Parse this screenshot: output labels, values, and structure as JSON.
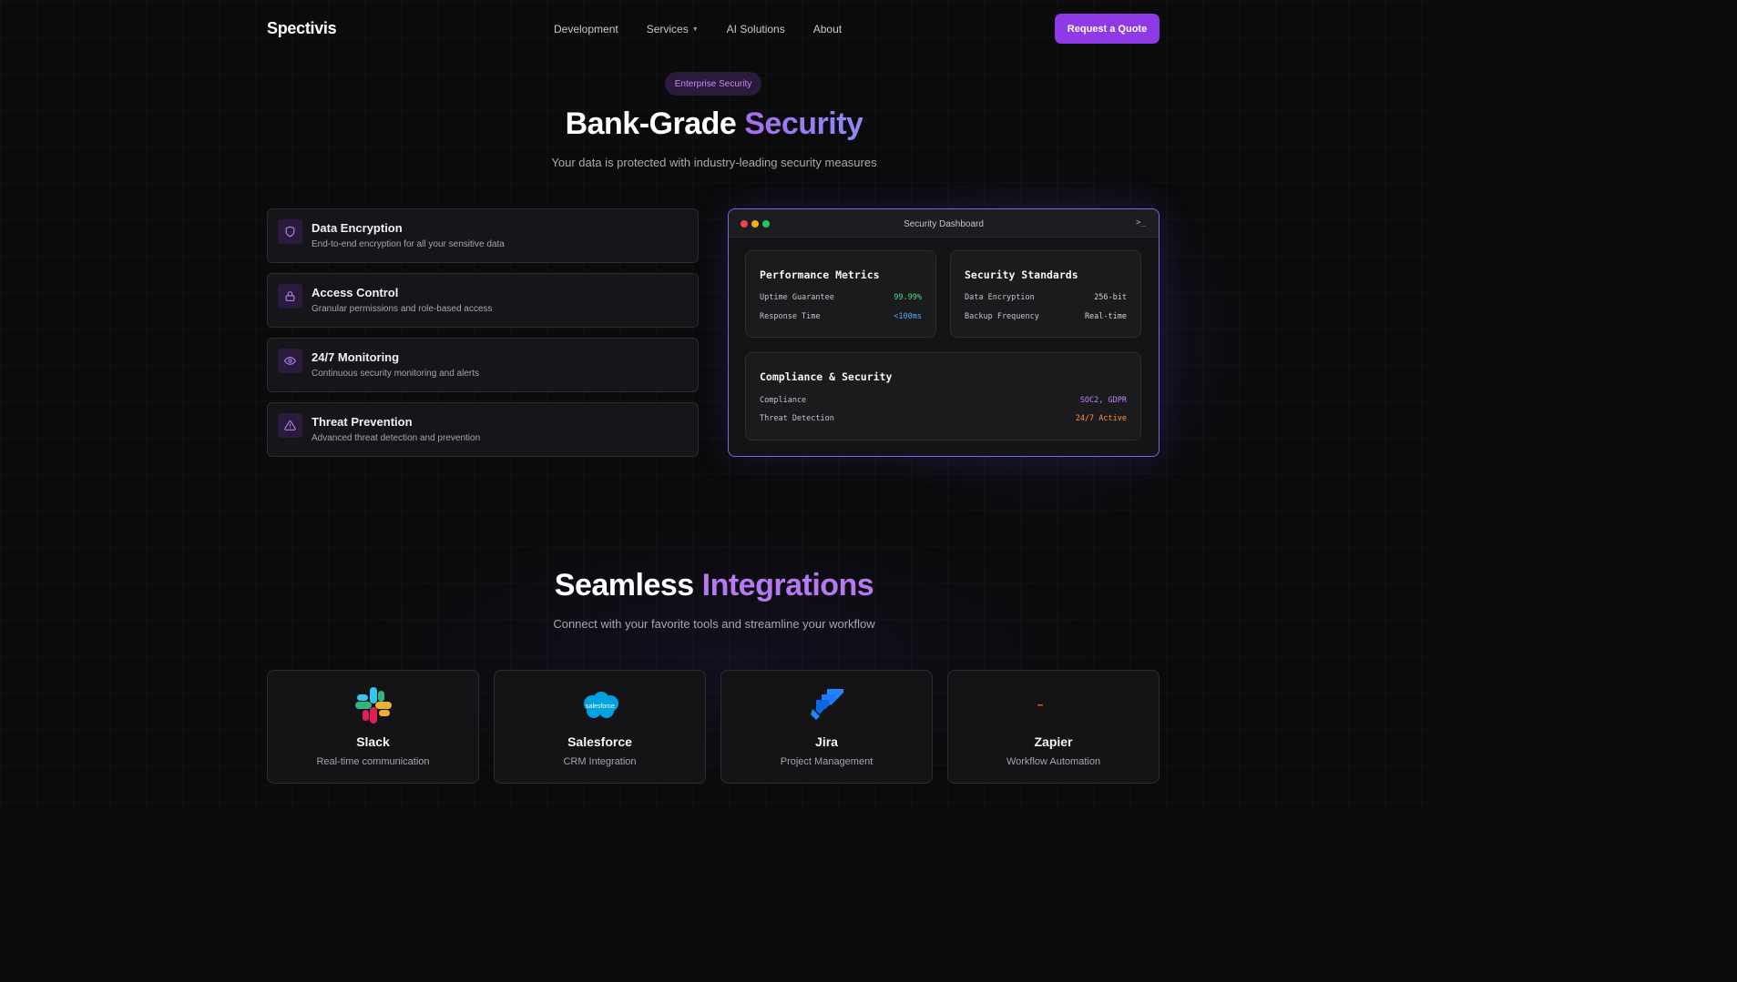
{
  "nav": {
    "logo": "Spectivis",
    "links": [
      "Development",
      "Services",
      "AI Solutions",
      "About"
    ],
    "cta": "Request a Quote"
  },
  "security": {
    "badge": "Enterprise Security",
    "title_main": "Bank-Grade ",
    "title_accent": "Security",
    "subtitle": "Your data is protected with industry-leading security measures",
    "features": [
      {
        "title": "Data Encryption",
        "desc": "End-to-end encryption for all your sensitive data",
        "icon": "shield-icon"
      },
      {
        "title": "Access Control",
        "desc": "Granular permissions and role-based access",
        "icon": "lock-icon"
      },
      {
        "title": "24/7 Monitoring",
        "desc": "Continuous security monitoring and alerts",
        "icon": "eye-icon"
      },
      {
        "title": "Threat Prevention",
        "desc": "Advanced threat detection and prevention",
        "icon": "warning-icon"
      }
    ]
  },
  "dashboard": {
    "title": "Security Dashboard",
    "terminal_icon": ">_",
    "performance": {
      "title": "Performance Metrics",
      "rows": [
        {
          "label": "Uptime Guarantee",
          "value": "99.99%",
          "color": "#4ade80"
        },
        {
          "label": "Response Time",
          "value": "<100ms",
          "color": "#60a5fa"
        }
      ]
    },
    "standards": {
      "title": "Security Standards",
      "rows": [
        {
          "label": "Data Encryption",
          "value": "256-bit",
          "color": "#d4d4d8"
        },
        {
          "label": "Backup Frequency",
          "value": "Real-time",
          "color": "#d4d4d8"
        }
      ]
    },
    "compliance": {
      "title": "Compliance & Security",
      "rows": [
        {
          "label": "Compliance",
          "value": "SOC2, GDPR",
          "color": "#c084fc"
        },
        {
          "label": "Threat Detection",
          "value": "24/7 Active",
          "color": "#fb923c"
        }
      ]
    }
  },
  "integrations": {
    "title_main": "Seamless ",
    "title_accent": "Integrations",
    "subtitle": "Connect with your favorite tools and streamline your workflow",
    "items": [
      {
        "name": "Slack",
        "desc": "Real-time communication",
        "icon": "slack-logo-icon"
      },
      {
        "name": "Salesforce",
        "desc": "CRM Integration",
        "icon": "salesforce-logo-icon",
        "logo_text": "salesforce"
      },
      {
        "name": "Jira",
        "desc": "Project Management",
        "icon": "jira-logo-icon"
      },
      {
        "name": "Zapier",
        "desc": "Workflow Automation",
        "icon": "zapier-logo-icon"
      }
    ]
  }
}
